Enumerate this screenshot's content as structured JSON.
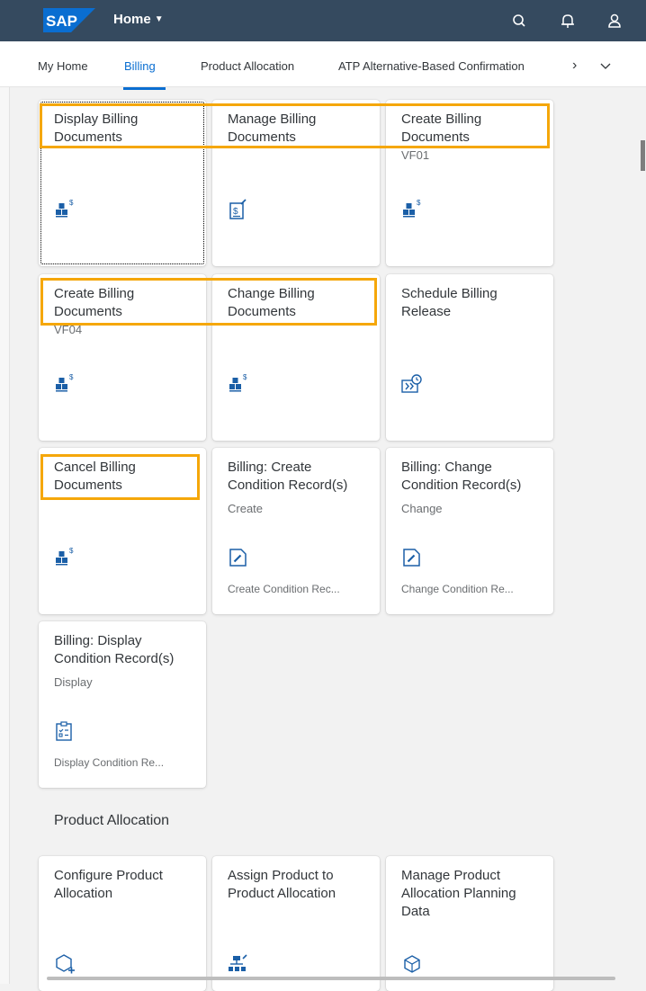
{
  "shell": {
    "logo_text": "SAP",
    "home_label": "Home",
    "colors": {
      "header_bg": "#354a5f",
      "logo_blue": "#0a6ed1",
      "accent": "#0a6ed1",
      "highlight": "#f5a70a"
    },
    "icons": [
      "search-icon",
      "notifications-icon",
      "user-icon"
    ]
  },
  "tabs": {
    "items": [
      {
        "label": "My Home"
      },
      {
        "label": "Billing"
      },
      {
        "label": "Product Allocation"
      },
      {
        "label": "ATP Alternative-Based Confirmation"
      }
    ],
    "active": "Billing"
  },
  "tiles": [
    {
      "title": "Display Billing Documents",
      "subtitle": "",
      "icon": "billing-documents-icon",
      "footer": ""
    },
    {
      "title": "Manage Billing Documents",
      "subtitle": "",
      "icon": "manage-billing-icon",
      "footer": ""
    },
    {
      "title": "Create Billing Documents",
      "subtitle": "VF01",
      "icon": "billing-documents-icon",
      "footer": ""
    },
    {
      "title": "Create Billing Documents",
      "subtitle": "VF04",
      "icon": "billing-documents-icon",
      "footer": ""
    },
    {
      "title": "Change Billing Documents",
      "subtitle": "",
      "icon": "billing-documents-icon",
      "footer": ""
    },
    {
      "title": "Schedule Billing Release",
      "subtitle": "",
      "icon": "schedule-icon",
      "footer": ""
    },
    {
      "title": "Cancel Billing Documents",
      "subtitle": "",
      "icon": "billing-documents-icon",
      "footer": ""
    },
    {
      "title": "Billing: Create Condition Record(s)",
      "subtitle": "Create",
      "icon": "edit-document-icon",
      "footer": "Create Condition Rec..."
    },
    {
      "title": "Billing: Change Condition Record(s)",
      "subtitle": "Change",
      "icon": "edit-document-icon",
      "footer": "Change Condition Re..."
    },
    {
      "title": "Billing: Display Condition Record(s)",
      "subtitle": "Display",
      "icon": "checklist-icon",
      "footer": "Display Condition Re..."
    }
  ],
  "product_allocation": {
    "section_title": "Product Allocation",
    "tiles": [
      {
        "title": "Configure Product Allocation",
        "icon": "configure-add-icon"
      },
      {
        "title": "Assign Product to Product Allocation",
        "icon": "hierarchy-assign-icon"
      },
      {
        "title": "Manage Product Allocation Planning Data",
        "icon": "cube-icon"
      }
    ]
  }
}
